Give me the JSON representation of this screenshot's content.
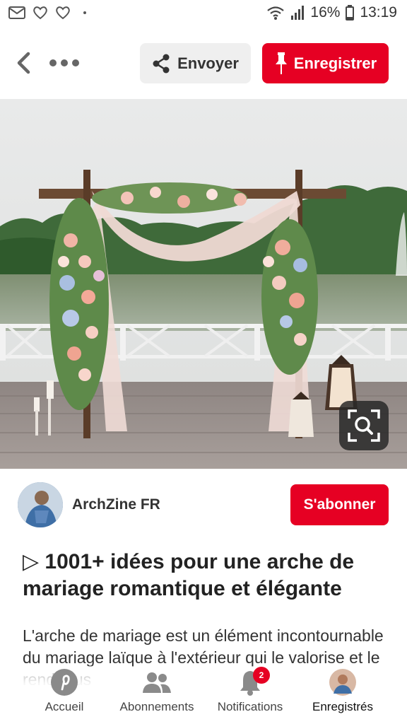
{
  "status_bar": {
    "battery": "16%",
    "time": "13:19"
  },
  "toolbar": {
    "send_label": "Envoyer",
    "save_label": "Enregistrer"
  },
  "creator": {
    "name": "ArchZine FR",
    "follow_label": "S'abonner"
  },
  "pin": {
    "title": "▷ 1001+ idées pour une arche de mariage romantique et élégante",
    "description": "L'arche de mariage est un élément incontournable du mariage laïque à l'extérieur qui le valorise et le rend Plus"
  },
  "bottom_nav": {
    "items": [
      {
        "label": "Accueil",
        "icon": "pinterest-icon"
      },
      {
        "label": "Abonnements",
        "icon": "people-icon"
      },
      {
        "label": "Notifications",
        "icon": "bell-icon",
        "badge": "2"
      },
      {
        "label": "Enregistrés",
        "icon": "profile-avatar"
      }
    ]
  },
  "colors": {
    "brand_red": "#e60023"
  }
}
